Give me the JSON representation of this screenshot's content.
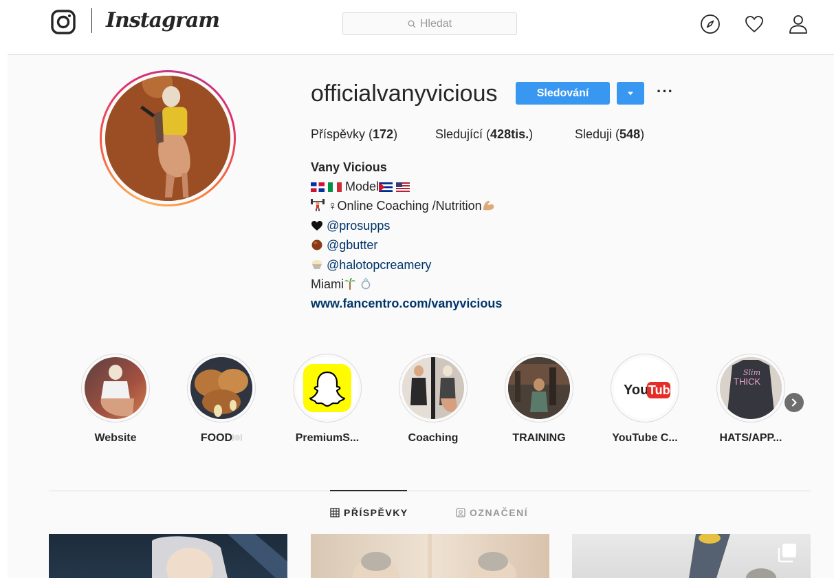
{
  "header": {
    "brand_wordmark": "Instagram",
    "search_placeholder": "Hledat",
    "icons": [
      "instagram-glyph-icon",
      "compass-icon",
      "heart-icon",
      "person-icon"
    ]
  },
  "profile": {
    "username": "officialvanyvicious",
    "follow_button": "Sledování",
    "more_button": "···",
    "stats": {
      "posts_label": "Příspěvky",
      "posts_value": "172",
      "followers_label": "Sledující",
      "followers_value": "428tis.",
      "following_label": "Sleduji",
      "following_value": "548"
    },
    "full_name": "Vany Vicious",
    "bio": {
      "line1_text": "Model",
      "line2_text": "♀Online Coaching /Nutrition",
      "mention1": "@prosupps",
      "mention2": "@gbutter",
      "mention3": "@halotopcreamery",
      "line6_text": "Miami"
    },
    "website": "www.fancentro.com/vanyvicious"
  },
  "highlights": [
    {
      "label": "Website"
    },
    {
      "label": "FOOD"
    },
    {
      "label": "PremiumS..."
    },
    {
      "label": "Coaching"
    },
    {
      "label": "TRAINING"
    },
    {
      "label": "YouTube C..."
    },
    {
      "label": "HATS/APP..."
    }
  ],
  "youtube_logo": {
    "you": "You",
    "tube": "Tube"
  },
  "shirt_text": {
    "line1": "Slim",
    "line2": "THICK"
  },
  "tabs": {
    "posts": "PŘÍSPĚVKY",
    "tagged": "OZNAČENÍ"
  },
  "colors": {
    "accent": "#3897f0",
    "link": "#003569",
    "text": "#262626",
    "muted": "#999999",
    "border": "#dbdbdb",
    "background": "#fafafa"
  }
}
